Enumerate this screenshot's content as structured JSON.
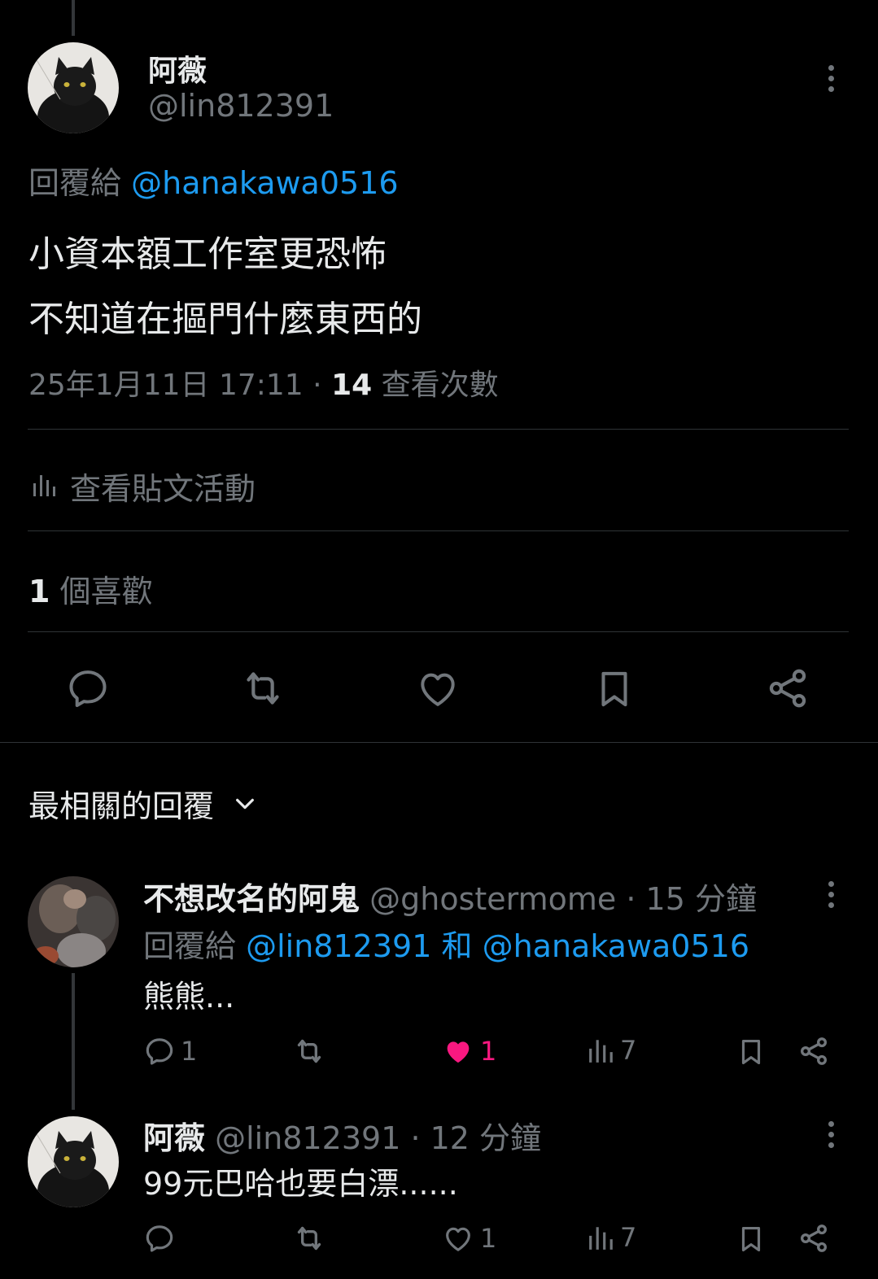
{
  "main_tweet": {
    "display_name": "阿薇",
    "handle": "@lin812391",
    "reply_prefix": "回覆給",
    "reply_to": "@hanakawa0516",
    "text_line1": "小資本額工作室更恐怖",
    "text_line2": "不知道在摳門什麼東西的",
    "timestamp": "25年1月11日 17:11",
    "separator": "·",
    "views_count": "14",
    "views_label": "查看次數",
    "activity_label": "查看貼文活動",
    "likes_count": "1",
    "likes_label": "個喜歡"
  },
  "replies_header": {
    "label": "最相關的回覆"
  },
  "reply1": {
    "display_name": "不想改名的阿鬼",
    "handle": "@ghostermome",
    "time": "· 15 分鐘",
    "reply_prefix": "回覆給",
    "reply_to_1": "@lin812391",
    "reply_and": "和",
    "reply_to_2": "@hanakawa0516",
    "text": "熊熊...",
    "reply_count": "1",
    "like_count": "1",
    "view_count": "7"
  },
  "reply2": {
    "display_name": "阿薇",
    "handle": "@lin812391",
    "time": "· 12 分鐘",
    "text": "99元巴哈也要白漂......",
    "like_count": "1",
    "view_count": "7"
  },
  "colors": {
    "link": "#1d9bf0",
    "like_active": "#f91880",
    "muted": "#71767b"
  }
}
